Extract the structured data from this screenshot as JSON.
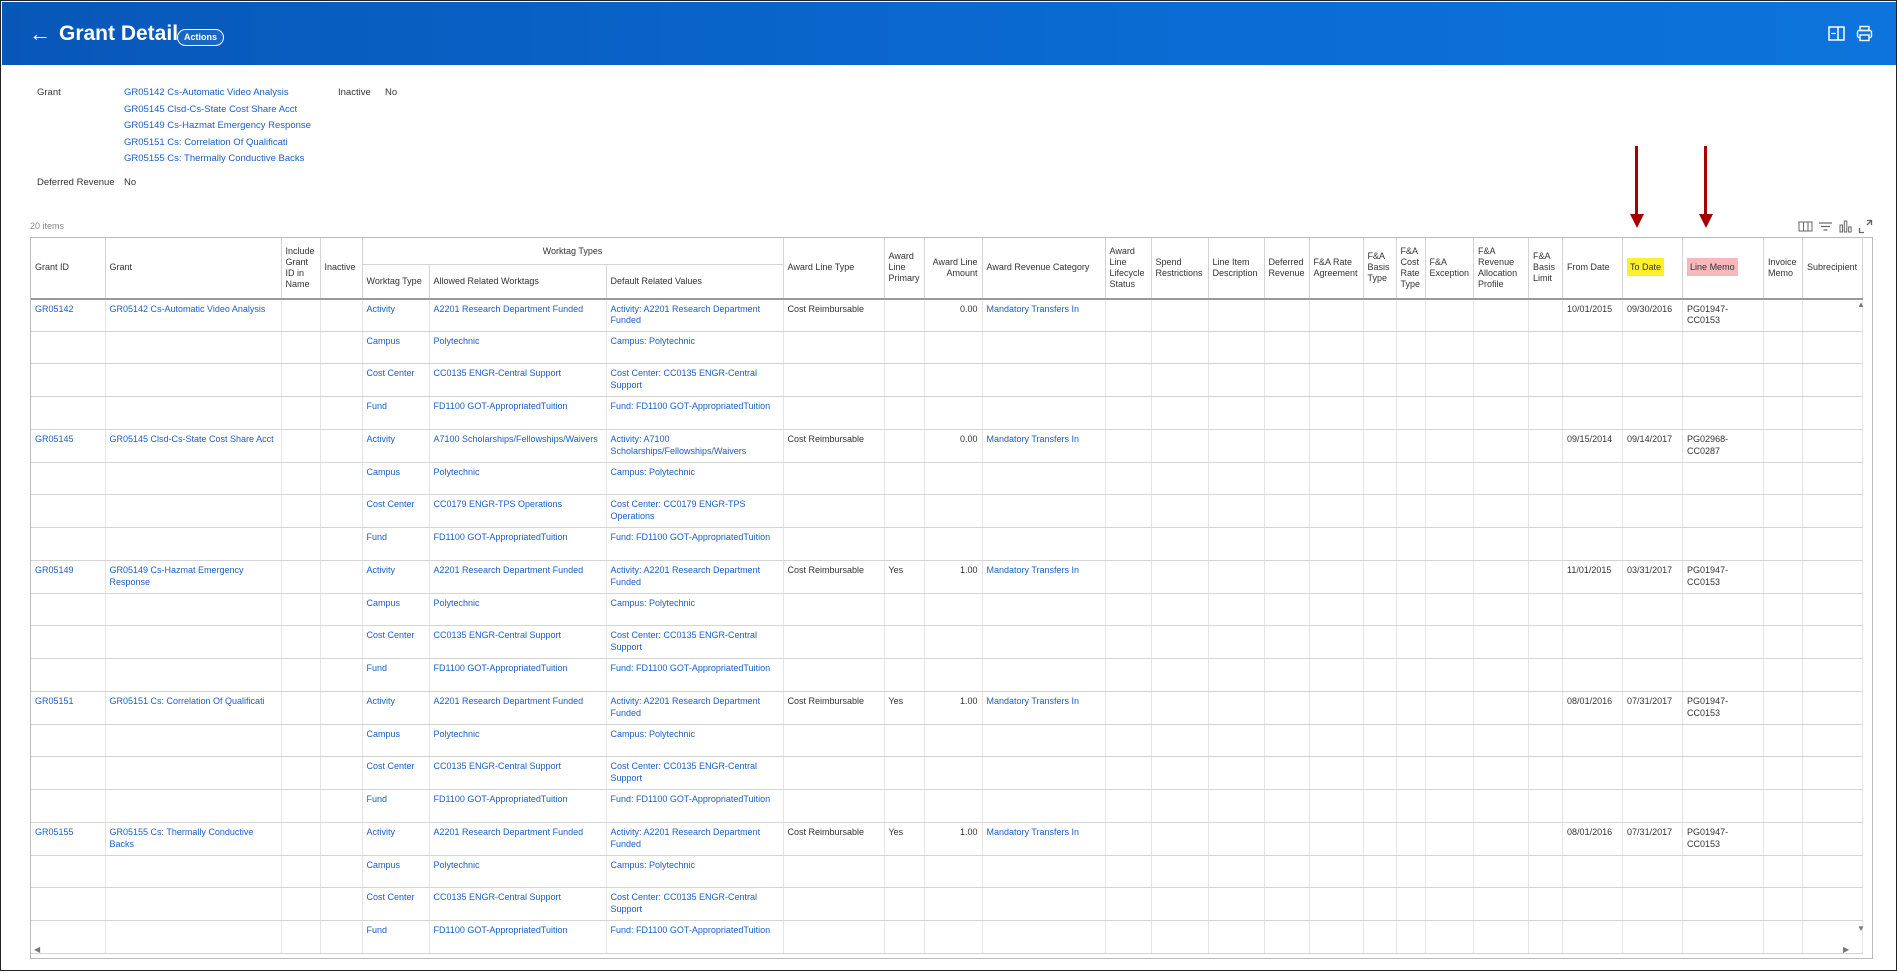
{
  "header": {
    "back_icon": "arrow-left-icon",
    "title": "Grant Detail",
    "actions_label": "Actions",
    "icons": [
      "side-panel-icon",
      "print-icon"
    ]
  },
  "fields": {
    "grant_label": "Grant",
    "grants": [
      "GR05142 Cs-Automatic Video Analysis",
      "GR05145 Clsd-Cs-State Cost Share Acct",
      "GR05149 Cs-Hazmat Emergency Response",
      "GR05151 Cs: Correlation Of Qualificati",
      "GR05155 Cs: Thermally Conductive Backs"
    ],
    "inactive_label": "Inactive",
    "inactive_value": "No",
    "deferred_label": "Deferred Revenue",
    "deferred_value": "No"
  },
  "table_info": {
    "count": "20 items",
    "icons": [
      "column-toggle-icon",
      "filter-icon",
      "chart-icon",
      "expand-icon"
    ]
  },
  "table": {
    "group_header": "Worktag Types",
    "columns": {
      "grant_id": "Grant ID",
      "grant": "Grant",
      "include": "Include Grant ID in Name",
      "inactive": "Inactive",
      "worktag_type": "Worktag Type",
      "allowed": "Allowed Related Worktags",
      "default": "Default Related Values",
      "award_line_type": "Award Line Type",
      "primary": "Award Line Primary",
      "amount": "Award Line Amount",
      "revenue_cat": "Award Revenue Category",
      "lifecycle": "Award Line Lifecycle Status",
      "spend": "Spend Restrictions",
      "desc": "Line Item Description",
      "deferred": "Deferred Revenue",
      "fa_rate": "F&A Rate Agreement",
      "fa_basis": "F&A Basis Type",
      "fa_cost": "F&A Cost Rate Type",
      "fa_exception": "F&A Exception",
      "fa_profile": "F&A Revenue Allocation Profile",
      "fa_limit": "F&A Basis Limit",
      "from": "From Date",
      "to": "To Date",
      "memo": "Line Memo",
      "invoice": "Invoice Memo",
      "sub": "Subrecipient"
    },
    "highlight_colors": {
      "to_date": "#ffef2f",
      "line_memo": "#f5b8bb",
      "arrow": "#a80000"
    },
    "grants": [
      {
        "id": "GR05142",
        "name": "GR05142 Cs-Automatic Video Analysis",
        "award_line_type": "Cost Reimbursable",
        "primary": "",
        "amount": "0.00",
        "revenue_cat": "Mandatory Transfers In",
        "from": "10/01/2015",
        "to": "09/30/2016",
        "memo": "PG01947-CC0153",
        "worktags": [
          {
            "type": "Activity",
            "allowed": "A2201 Research Department Funded",
            "default": "Activity: A2201 Research Department Funded"
          },
          {
            "type": "Campus",
            "allowed": "Polytechnic",
            "default": "Campus: Polytechnic"
          },
          {
            "type": "Cost Center",
            "allowed": "CC0135 ENGR-Central Support",
            "default": "Cost Center: CC0135 ENGR-Central Support"
          },
          {
            "type": "Fund",
            "allowed": "FD1100 GOT-AppropriatedTuition",
            "default": "Fund: FD1100 GOT-AppropriatedTuition"
          }
        ]
      },
      {
        "id": "GR05145",
        "name": "GR05145 Clsd-Cs-State Cost Share Acct",
        "award_line_type": "Cost Reimbursable",
        "primary": "",
        "amount": "0.00",
        "revenue_cat": "Mandatory Transfers In",
        "from": "09/15/2014",
        "to": "09/14/2017",
        "memo": "PG02968-CC0287",
        "worktags": [
          {
            "type": "Activity",
            "allowed": "A7100 Scholarships/Fellowships/Waivers",
            "default": "Activity: A7100 Scholarships/Fellowships/Waivers"
          },
          {
            "type": "Campus",
            "allowed": "Polytechnic",
            "default": "Campus: Polytechnic"
          },
          {
            "type": "Cost Center",
            "allowed": "CC0179 ENGR-TPS Operations",
            "default": "Cost Center: CC0179 ENGR-TPS Operations"
          },
          {
            "type": "Fund",
            "allowed": "FD1100 GOT-AppropriatedTuition",
            "default": "Fund: FD1100 GOT-AppropriatedTuition"
          }
        ]
      },
      {
        "id": "GR05149",
        "name": "GR05149 Cs-Hazmat Emergency Response",
        "award_line_type": "Cost Reimbursable",
        "primary": "Yes",
        "amount": "1.00",
        "revenue_cat": "Mandatory Transfers In",
        "from": "11/01/2015",
        "to": "03/31/2017",
        "memo": "PG01947-CC0153",
        "worktags": [
          {
            "type": "Activity",
            "allowed": "A2201 Research Department Funded",
            "default": "Activity: A2201 Research Department Funded"
          },
          {
            "type": "Campus",
            "allowed": "Polytechnic",
            "default": "Campus: Polytechnic"
          },
          {
            "type": "Cost Center",
            "allowed": "CC0135 ENGR-Central Support",
            "default": "Cost Center: CC0135 ENGR-Central Support"
          },
          {
            "type": "Fund",
            "allowed": "FD1100 GOT-AppropriatedTuition",
            "default": "Fund: FD1100 GOT-AppropriatedTuition"
          }
        ]
      },
      {
        "id": "GR05151",
        "name": "GR05151 Cs: Correlation Of Qualificati",
        "award_line_type": "Cost Reimbursable",
        "primary": "Yes",
        "amount": "1.00",
        "revenue_cat": "Mandatory Transfers In",
        "from": "08/01/2016",
        "to": "07/31/2017",
        "memo": "PG01947-CC0153",
        "worktags": [
          {
            "type": "Activity",
            "allowed": "A2201 Research Department Funded",
            "default": "Activity: A2201 Research Department Funded"
          },
          {
            "type": "Campus",
            "allowed": "Polytechnic",
            "default": "Campus: Polytechnic"
          },
          {
            "type": "Cost Center",
            "allowed": "CC0135 ENGR-Central Support",
            "default": "Cost Center: CC0135 ENGR-Central Support"
          },
          {
            "type": "Fund",
            "allowed": "FD1100 GOT-AppropriatedTuition",
            "default": "Fund: FD1100 GOT-AppropriatedTuition"
          }
        ]
      },
      {
        "id": "GR05155",
        "name": "GR05155 Cs: Thermally Conductive Backs",
        "award_line_type": "Cost Reimbursable",
        "primary": "Yes",
        "amount": "1.00",
        "revenue_cat": "Mandatory Transfers In",
        "from": "08/01/2016",
        "to": "07/31/2017",
        "memo": "PG01947-CC0153",
        "worktags": [
          {
            "type": "Activity",
            "allowed": "A2201 Research Department Funded",
            "default": "Activity: A2201 Research Department Funded"
          },
          {
            "type": "Campus",
            "allowed": "Polytechnic",
            "default": "Campus: Polytechnic"
          },
          {
            "type": "Cost Center",
            "allowed": "CC0135 ENGR-Central Support",
            "default": "Cost Center: CC0135 ENGR-Central Support"
          },
          {
            "type": "Fund",
            "allowed": "FD1100 GOT-AppropriatedTuition",
            "default": "Fund: FD1100 GOT-AppropriatedTuition"
          }
        ]
      }
    ]
  }
}
